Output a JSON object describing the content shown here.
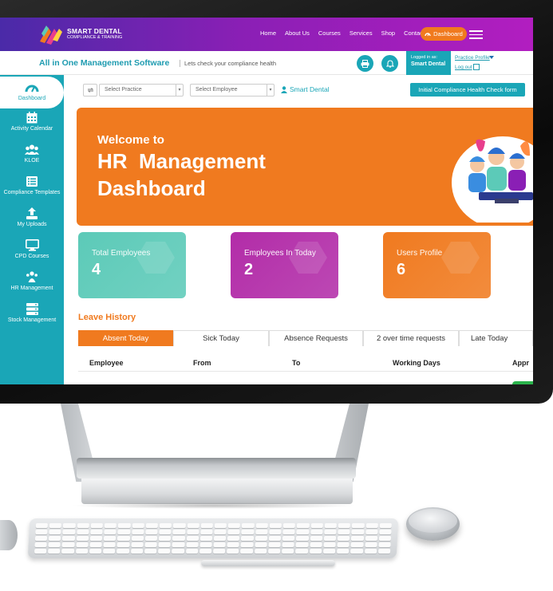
{
  "nav": {
    "brand_title": "SMART DENTAL",
    "brand_sub": "COMPLIANCE & TRAINING",
    "links": [
      "Home",
      "About Us",
      "Courses",
      "Services",
      "Shop",
      "Contact"
    ],
    "dashboard_label": "Dashboard"
  },
  "header": {
    "title": "All in One Management Software",
    "tagline": "Lets check your compliance health",
    "logged_in_label": "Logged in as:",
    "logged_in_name": "Smart Dental",
    "practice_profile": "Practice Profile",
    "log_out": "Log out"
  },
  "sidebar": {
    "items": [
      {
        "label": "Dashboard",
        "icon": "gauge-icon"
      },
      {
        "label": "Activity Calendar",
        "icon": "calendar-icon"
      },
      {
        "label": "KLOE",
        "icon": "users-icon"
      },
      {
        "label": "Compliance Templates",
        "icon": "list-icon"
      },
      {
        "label": "My Uploads",
        "icon": "upload-icon"
      },
      {
        "label": "CPD Courses",
        "icon": "monitor-icon"
      },
      {
        "label": "HR Management",
        "icon": "team-icon"
      },
      {
        "label": "Stock Management",
        "icon": "server-icon"
      }
    ]
  },
  "filters": {
    "practice_placeholder": "Select Practice",
    "employee_placeholder": "Select Employee",
    "brand": "Smart Dental",
    "check_button": "Initial Compliance Health Check form"
  },
  "banner": {
    "welcome": "Welcome to",
    "title_line1": "HR  Management",
    "title_line2": "Dashboard"
  },
  "stats": [
    {
      "label": "Total Employees",
      "value": "4",
      "color": "#5ccab8"
    },
    {
      "label": "Employees In Today",
      "value": "2",
      "color": "#b22ca8"
    },
    {
      "label": "Users Profile",
      "value": "6",
      "color": "#f07a1f"
    }
  ],
  "leave": {
    "title": "Leave History",
    "tabs": [
      "Absent Today",
      "Sick Today",
      "Absence Requests",
      "2 over time requests",
      "Late Today"
    ],
    "columns": [
      "Employee",
      "From",
      "To",
      "Working Days",
      "Appr"
    ]
  },
  "colors": {
    "teal": "#1aa6b7",
    "orange": "#f07a1f",
    "purple": "#8a1fb5"
  }
}
